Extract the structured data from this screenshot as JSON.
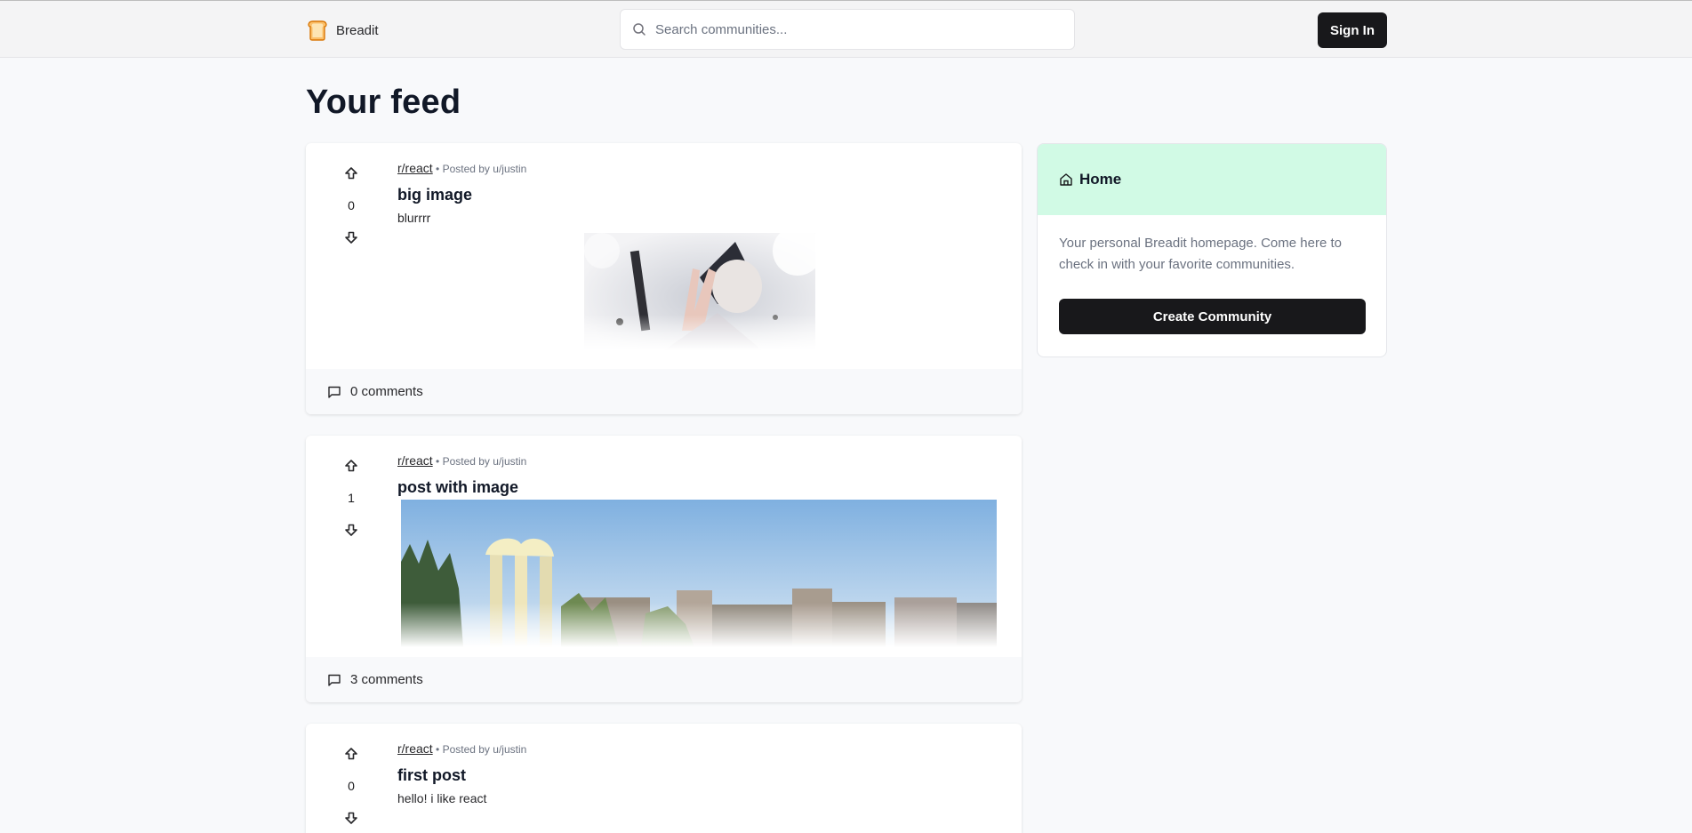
{
  "header": {
    "brand_name": "Breadit",
    "search_placeholder": "Search communities...",
    "signin_label": "Sign In"
  },
  "page": {
    "title": "Your feed"
  },
  "posts": [
    {
      "subreddit": "r/react",
      "posted_by": "• Posted by u/justin",
      "votes": "0",
      "title": "big image",
      "text": "blurrrr",
      "comments": "0 comments"
    },
    {
      "subreddit": "r/react",
      "posted_by": "• Posted by u/justin",
      "votes": "1",
      "title": "post with image",
      "text": "",
      "comments": "3 comments"
    },
    {
      "subreddit": "r/react",
      "posted_by": "• Posted by u/justin",
      "votes": "0",
      "title": "first post",
      "text": "hello! i like react",
      "comments": ""
    }
  ],
  "sidebar": {
    "title": "Home",
    "description": "Your personal Breadit homepage. Come here to check in with your favorite communities.",
    "create_label": "Create Community"
  },
  "colors": {
    "sidebar_header_bg": "#d1fae5",
    "button_dark": "#18181b",
    "page_bg": "#f8f9fb"
  }
}
